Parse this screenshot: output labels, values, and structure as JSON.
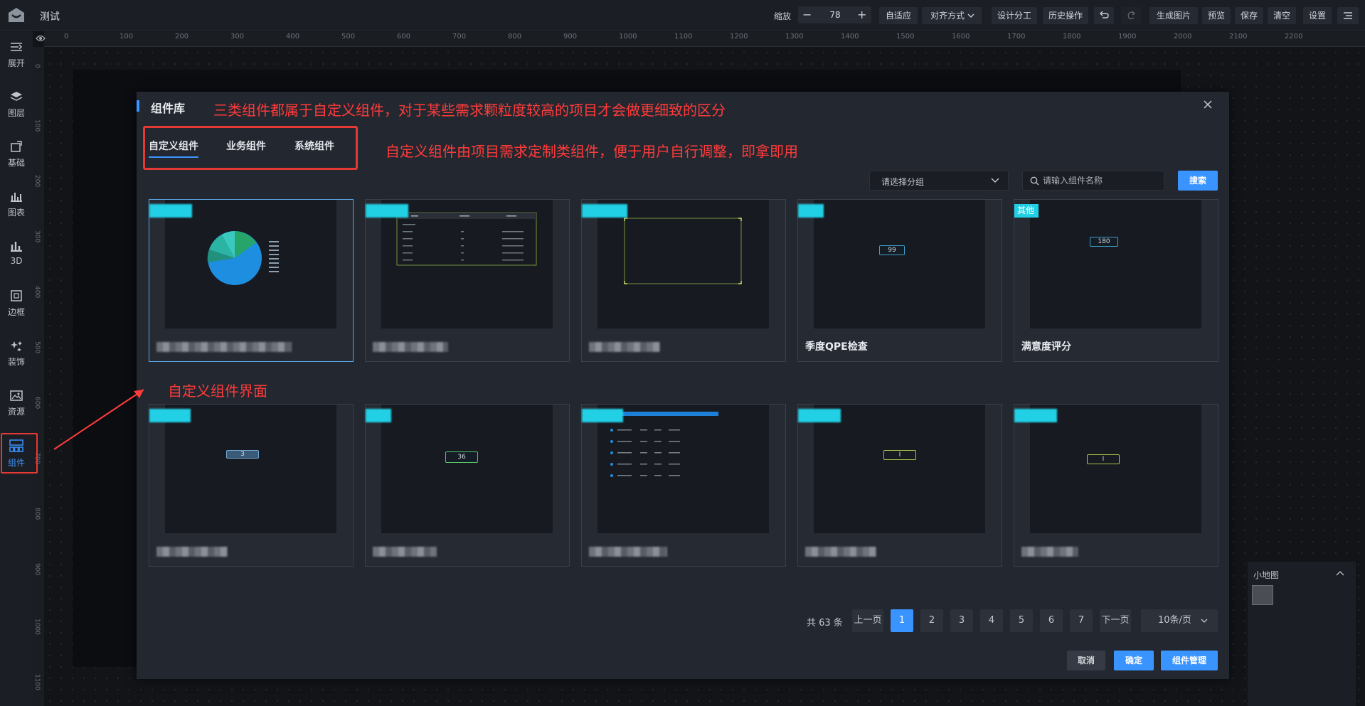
{
  "app": {
    "title": "测试"
  },
  "toolbar": {
    "zoom_label": "缩放",
    "zoom_value": "78",
    "zoom_minus": "−",
    "zoom_plus": "+",
    "buttons": [
      "自适应",
      "对齐方式",
      "设计分工",
      "历史操作",
      "生成图片",
      "预览",
      "保存",
      "清空",
      "设置"
    ]
  },
  "sidebar": {
    "items": [
      {
        "label": "展开",
        "icon": "expand-icon"
      },
      {
        "label": "图层",
        "icon": "layers-icon"
      },
      {
        "label": "基础",
        "icon": "basic-icon"
      },
      {
        "label": "图表",
        "icon": "chart-icon"
      },
      {
        "label": "3D",
        "icon": "3d-icon"
      },
      {
        "label": "边框",
        "icon": "border-icon"
      },
      {
        "label": "装饰",
        "icon": "decoration-icon"
      },
      {
        "label": "资源",
        "icon": "resource-icon"
      },
      {
        "label": "组件",
        "icon": "component-icon"
      }
    ],
    "active": "组件"
  },
  "ruler": {
    "top_ticks": [
      "0",
      "100",
      "200",
      "300",
      "400",
      "500",
      "600",
      "700",
      "800",
      "900",
      "1000",
      "1100",
      "1200",
      "1300",
      "1400",
      "1500",
      "1600",
      "1700",
      "1800",
      "1900",
      "2000",
      "2100",
      "2200"
    ],
    "left_ticks": [
      "0",
      "100",
      "200",
      "300",
      "400",
      "500",
      "600",
      "700",
      "800",
      "900",
      "1000",
      "1100"
    ]
  },
  "modal": {
    "title": "组件库",
    "tabs": [
      "自定义组件",
      "业务组件",
      "系统组件"
    ],
    "active_tab": "自定义组件",
    "group_select": {
      "placeholder": "请选择分组"
    },
    "search": {
      "placeholder": "请输入组件名称",
      "button": "搜索"
    },
    "cards": [
      {
        "name": "",
        "badge": "",
        "kind": "pie"
      },
      {
        "name": "",
        "badge": "",
        "kind": "table"
      },
      {
        "name": "",
        "badge": "",
        "kind": "frame"
      },
      {
        "name": "季度QPE检查",
        "badge": "",
        "kind": "value",
        "value": "99"
      },
      {
        "name": "满意度评分",
        "badge": "其他",
        "kind": "value",
        "value": "180"
      },
      {
        "name": "",
        "badge": "",
        "kind": "value",
        "value": "3"
      },
      {
        "name": "",
        "badge": "",
        "kind": "value",
        "value": "36"
      },
      {
        "name": "",
        "badge": "",
        "kind": "list"
      },
      {
        "name": "",
        "badge": "",
        "kind": "value",
        "value": "I"
      },
      {
        "name": "",
        "badge": "",
        "kind": "value",
        "value": "I"
      }
    ],
    "pagination": {
      "total": "共 63 条",
      "prev": "上一页",
      "next": "下一页",
      "pages": [
        "1",
        "2",
        "3",
        "4",
        "5",
        "6",
        "7"
      ],
      "current": "1",
      "page_size": "10条/页"
    },
    "footer": {
      "cancel": "取消",
      "confirm": "确定",
      "manage": "组件管理"
    }
  },
  "annotations": {
    "title_note": "三类组件都属于自定义组件，对于某些需求颗粒度较高的项目才会做更细致的区分",
    "tab_note": "自定义组件由项目需求定制类组件，便于用户自行调整，即拿即用",
    "ui_note": "自定义组件界面"
  },
  "minimap": {
    "title": "小地图"
  },
  "colors": {
    "accent": "#3a94ff",
    "annotation": "#ff3b3b",
    "badge": "#22d0e6"
  }
}
